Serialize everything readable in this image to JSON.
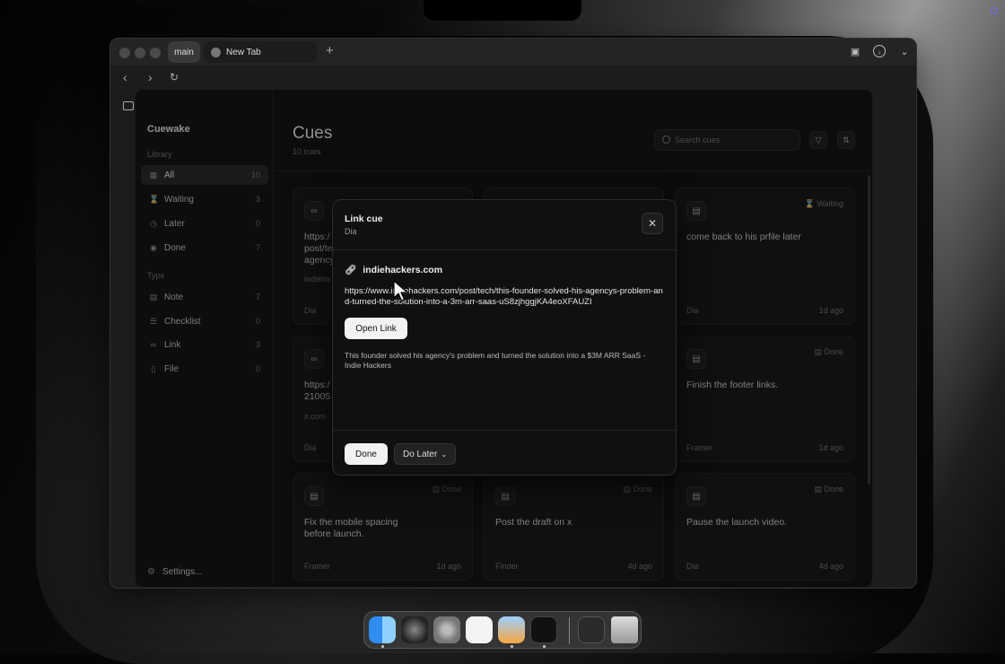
{
  "browser": {
    "tabs": [
      {
        "label": "main"
      },
      {
        "label": "New Tab"
      }
    ]
  },
  "app": {
    "name": "Cuewake",
    "sections": {
      "library": "Library",
      "type": "Type"
    },
    "library_items": [
      {
        "label": "All",
        "count": "10",
        "icon": "grid-icon"
      },
      {
        "label": "Waiting",
        "count": "3",
        "icon": "hourglass-icon"
      },
      {
        "label": "Later",
        "count": "0",
        "icon": "clock-icon"
      },
      {
        "label": "Done",
        "count": "7",
        "icon": "check-circle-icon"
      }
    ],
    "type_items": [
      {
        "label": "Note",
        "count": "7",
        "icon": "note-icon"
      },
      {
        "label": "Checklist",
        "count": "0",
        "icon": "checklist-icon"
      },
      {
        "label": "Link",
        "count": "3",
        "icon": "link-icon"
      },
      {
        "label": "File",
        "count": "0",
        "icon": "file-icon"
      }
    ],
    "settings_label": "Settings..."
  },
  "main": {
    "title": "Cues",
    "subtitle": "10 cues",
    "search_placeholder": "Search cues"
  },
  "cards": [
    {
      "text": "https:/\npost/te\nagency",
      "sub": "indieha",
      "source": "Dia",
      "time": "",
      "status": ""
    },
    {
      "text": "",
      "sub": "",
      "source": "",
      "time": "",
      "status": ""
    },
    {
      "text": "come back to his prfile later",
      "sub": "",
      "source": "Dia",
      "time": "1d ago",
      "status": "Waiting"
    },
    {
      "text": "https:/\n21005",
      "sub": "x.com",
      "source": "Dia",
      "time": "",
      "status": ""
    },
    {
      "text": "",
      "sub": "",
      "source": "",
      "time": "",
      "status": ""
    },
    {
      "text": "Finish the footer links.",
      "sub": "",
      "source": "Framer",
      "time": "1d ago",
      "status": "Done"
    },
    {
      "text": "Fix the mobile spacing before launch.",
      "sub": "",
      "source": "Framer",
      "time": "1d ago",
      "status": "Done"
    },
    {
      "text": "Post the draft on x",
      "sub": "",
      "source": "Finder",
      "time": "4d ago",
      "status": "Done"
    },
    {
      "text": "Pause the launch video.",
      "sub": "",
      "source": "Dia",
      "time": "4d ago",
      "status": "Done"
    }
  ],
  "modal": {
    "title": "Link cue",
    "subtitle": "Dia",
    "domain": "indiehackers.com",
    "url": "https://www.indiehackers.com/post/tech/this-founder-solved-his-agencys-problem-and-turned-the-solution-into-a-3m-arr-saas-uS8zjhggjKA4eoXFAUZI",
    "open_label": "Open Link",
    "description": "This founder solved his agency's problem and turned the solution into a $3M ARR SaaS - Indie Hackers",
    "done_label": "Done",
    "later_label": "Do Later"
  },
  "colors": {
    "accent_close": "#ff5f57",
    "accent_min": "#febc2e",
    "accent_max": "#28c840"
  }
}
